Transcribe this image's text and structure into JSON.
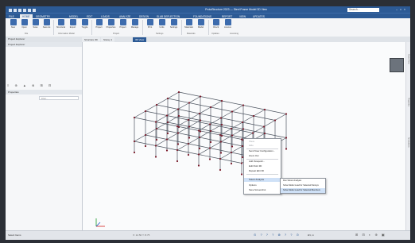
{
  "window": {
    "title": "ProtaStructure 2023 — Steel Frame Model 3D View",
    "search_placeholder": "Search...",
    "controls": [
      "–",
      "□",
      "×"
    ]
  },
  "quick_access_icons": [
    "app-icon",
    "new-icon",
    "open-icon",
    "save-icon",
    "undo-icon",
    "redo-icon"
  ],
  "menu": {
    "items": [
      {
        "label": "FILE"
      },
      {
        "label": "HOME",
        "active": true
      },
      {
        "label": "GEOMETRY"
      },
      {
        "label": "MODEL"
      },
      {
        "label": "EDIT"
      },
      {
        "label": "LOADS"
      },
      {
        "label": "ANALYZE"
      },
      {
        "label": "DESIGN"
      },
      {
        "label": "SLAB DEFLECTION"
      },
      {
        "label": "FOUNDATIONS"
      },
      {
        "label": "REPORT"
      },
      {
        "label": "VIEW"
      },
      {
        "label": "UPDATES"
      }
    ]
  },
  "ribbon": {
    "buttons": [
      {
        "label": "New",
        "icon": "new-file-icon"
      },
      {
        "label": "Open",
        "icon": "folder-open-icon"
      },
      {
        "label": "Save",
        "icon": "save-icon"
      },
      {
        "label": "Save As",
        "icon": "save-as-icon"
      },
      {
        "label": "Structural",
        "icon": "structure-icon"
      },
      {
        "label": "Export",
        "icon": "export-icon"
      },
      {
        "label": "Toggle",
        "icon": "toggle-icon"
      },
      {
        "label": "Project",
        "icon": "project-icon"
      },
      {
        "label": "Properties",
        "icon": "properties-icon"
      },
      {
        "label": "Project",
        "icon": "project-settings-icon"
      },
      {
        "label": "Manage",
        "icon": "manage-icon"
      },
      {
        "label": "Print",
        "icon": "print-icon"
      },
      {
        "label": "Units",
        "icon": "units-icon"
      },
      {
        "label": "Settings",
        "icon": "settings-icon"
      },
      {
        "label": "Materials",
        "icon": "materials-icon"
      },
      {
        "label": "Model",
        "icon": "model-icon"
      },
      {
        "label": "Check",
        "icon": "check-icon"
      },
      {
        "label": "Licence",
        "icon": "licence-icon"
      }
    ],
    "groups": [
      {
        "label": "File"
      },
      {
        "label": "Information Model"
      },
      {
        "label": "Project"
      },
      {
        "label": "Settings"
      },
      {
        "label": "Materials"
      },
      {
        "label": "Updates"
      },
      {
        "label": "Licensing"
      }
    ]
  },
  "tabs": {
    "panel_title": "Project Explorer",
    "views": [
      {
        "label": "Structure 3D"
      },
      {
        "label": "Storey 1"
      },
      {
        "label": "3D View",
        "active": true
      }
    ]
  },
  "left_panel": {
    "top_header": "Project Explorer",
    "mid_header": "Properties",
    "toolbar_glyphs": "≡ ⊕ ▲ ⊗ ⊞ ⊟",
    "filter_placeholder": "Filter..."
  },
  "context_menu": {
    "items": [
      {
        "label": "Show",
        "disabled": true
      },
      {
        "label": "Hide",
        "disabled": true
      },
      {
        "label": "Send View Configuration...",
        "disabled": false
      },
      {
        "label": "Zoom Out",
        "disabled": false
      },
      {
        "label": "Add Viewpoint...",
        "disabled": false
      },
      {
        "label": "Edit Point 3D",
        "disabled": false
      },
      {
        "label": "Repeat Edit 3D",
        "disabled": false
      },
      {
        "label": "Solver Analysis",
        "disabled": false,
        "highlighted": true
      },
      {
        "label": "Options",
        "disabled": false
      },
      {
        "label": "Save Screenshot",
        "disabled": false
      }
    ]
  },
  "submenu": {
    "items": [
      {
        "label": "Run Solver Analysis",
        "highlighted": false
      },
      {
        "label": "Solve Model Load for Selected Storeys",
        "highlighted": false
      },
      {
        "label": "Solve Model Load for Selected Members",
        "highlighted": true
      }
    ]
  },
  "right_strip": {
    "labels": [
      "Model View",
      "Properties",
      "Annotations"
    ]
  },
  "status": {
    "left_text": "Select Items",
    "coordinates": "X: 12.50  Y: 8.75",
    "units": "kN, m",
    "snap_glyphs": "⊙ ? ? ? ⊗ ? ? ⊙",
    "tool_glyphs": "⊞ ⊟ ◐ ⊕ ▣"
  },
  "axis_labels": {
    "x": "X",
    "y": "Y",
    "z": "Z"
  }
}
